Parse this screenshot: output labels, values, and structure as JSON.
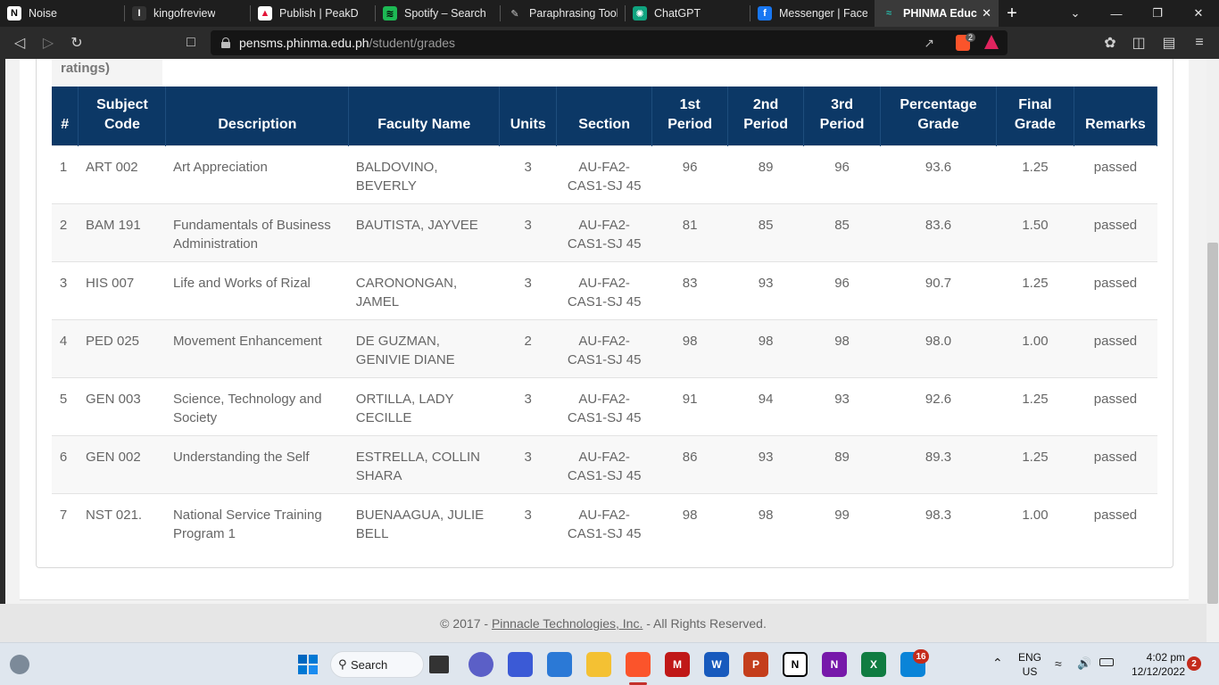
{
  "browser": {
    "tabs": [
      {
        "label": "Noise",
        "icon": "notion-icon"
      },
      {
        "label": "kingofreview",
        "icon": "kingofreview-icon"
      },
      {
        "label": "Publish | PeakD",
        "icon": "peakd-icon"
      },
      {
        "label": "Spotify – Search",
        "icon": "spotify-icon"
      },
      {
        "label": "Paraphrasing Tool |",
        "icon": "quill-icon"
      },
      {
        "label": "ChatGPT",
        "icon": "chatgpt-icon"
      },
      {
        "label": "Messenger | Faceb",
        "icon": "facebook-icon"
      },
      {
        "label": "PHINMA Educ",
        "icon": "phinma-icon",
        "active": true
      }
    ],
    "url_host": "pensms.phinma.edu.ph",
    "url_path": "/student/grades",
    "brave_badge": "2"
  },
  "page": {
    "ratings_label": "ratings)",
    "headers": [
      "#",
      "Subject Code",
      "Description",
      "Faculty Name",
      "Units",
      "Section",
      "1st Period",
      "2nd Period",
      "3rd Period",
      "Percentage Grade",
      "Final Grade",
      "Remarks"
    ],
    "rows": [
      {
        "num": "1",
        "code": "ART 002",
        "desc": "Art Appreciation",
        "faculty": "BALDOVINO, BEVERLY",
        "units": "3",
        "section": "AU-FA2-CAS1-SJ 45",
        "p1": "96",
        "p2": "89",
        "p3": "96",
        "pct": "93.6",
        "final": "1.25",
        "remarks": "passed"
      },
      {
        "num": "2",
        "code": "BAM 191",
        "desc": "Fundamentals of Business Administration",
        "faculty": "BAUTISTA, JAYVEE",
        "units": "3",
        "section": "AU-FA2-CAS1-SJ 45",
        "p1": "81",
        "p2": "85",
        "p3": "85",
        "pct": "83.6",
        "final": "1.50",
        "remarks": "passed"
      },
      {
        "num": "3",
        "code": "HIS 007",
        "desc": "Life and Works of Rizal",
        "faculty": "CARONONGAN, JAMEL",
        "units": "3",
        "section": "AU-FA2-CAS1-SJ 45",
        "p1": "83",
        "p2": "93",
        "p3": "96",
        "pct": "90.7",
        "final": "1.25",
        "remarks": "passed"
      },
      {
        "num": "4",
        "code": "PED 025",
        "desc": "Movement Enhancement",
        "faculty": "DE GUZMAN, GENIVIE DIANE",
        "units": "2",
        "section": "AU-FA2-CAS1-SJ 45",
        "p1": "98",
        "p2": "98",
        "p3": "98",
        "pct": "98.0",
        "final": "1.00",
        "remarks": "passed"
      },
      {
        "num": "5",
        "code": "GEN 003",
        "desc": "Science, Technology and Society",
        "faculty": "ORTILLA, LADY CECILLE",
        "units": "3",
        "section": "AU-FA2-CAS1-SJ 45",
        "p1": "91",
        "p2": "94",
        "p3": "93",
        "pct": "92.6",
        "final": "1.25",
        "remarks": "passed"
      },
      {
        "num": "6",
        "code": "GEN 002",
        "desc": "Understanding the Self",
        "faculty": "ESTRELLA, COLLIN SHARA",
        "units": "3",
        "section": "AU-FA2-CAS1-SJ 45",
        "p1": "86",
        "p2": "93",
        "p3": "89",
        "pct": "89.3",
        "final": "1.25",
        "remarks": "passed"
      },
      {
        "num": "7",
        "code": "NST 021.",
        "desc": "National Service Training Program 1",
        "faculty": "BUENAAGUA, JULIE BELL",
        "units": "3",
        "section": "AU-FA2-CAS1-SJ 45",
        "p1": "98",
        "p2": "98",
        "p3": "99",
        "pct": "98.3",
        "final": "1.00",
        "remarks": "passed"
      }
    ],
    "footer_prefix": "© 2017 - ",
    "footer_link": "Pinnacle Technologies, Inc.",
    "footer_suffix": " - All Rights Reserved."
  },
  "taskbar": {
    "search_label": "Search",
    "teams_badge": "16",
    "lang": "ENG",
    "region": "US",
    "time": "4:02 pm",
    "date": "12/12/2022",
    "notif_count": "2",
    "word_letter": "W",
    "ppt_letter": "P",
    "notion_letter": "N",
    "onenote_letter": "N",
    "excel_letter": "X",
    "mcafee_letter": "M"
  }
}
